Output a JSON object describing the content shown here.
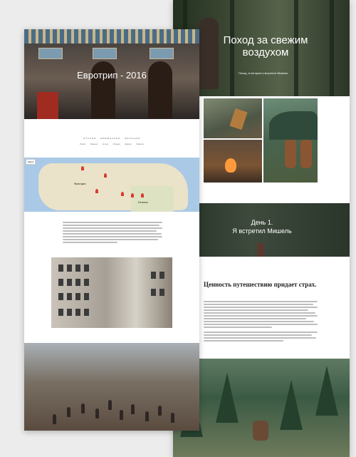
{
  "right_card": {
    "hero": {
      "logo": "",
      "title": "Поход за свежим воздухом",
      "subtitle": "Поход, в котором я встретил Мишель"
    },
    "band": {
      "title_line1": "День 1.",
      "title_line2": "Я встретил Мишель"
    },
    "article": {
      "heading": "Ценность путешествию придает страх."
    }
  },
  "left_card": {
    "hero": {
      "title": "Евротрип - 2016"
    },
    "nav": {
      "heading": "ИТАЛИЯ · ШВЕЙЦАРИЯ · ФРАНЦИЯ",
      "items": [
        "Италия",
        "Франция",
        "Англия",
        "Испания",
        "Швеция",
        "Норвегия"
      ]
    },
    "map": {
      "button": "Карта",
      "labels": [
        "Франция",
        "Италия"
      ]
    }
  },
  "colors": {
    "page_bg": "#ececec",
    "forest_dark": "#23301f",
    "hero_title": "#ffffff"
  }
}
